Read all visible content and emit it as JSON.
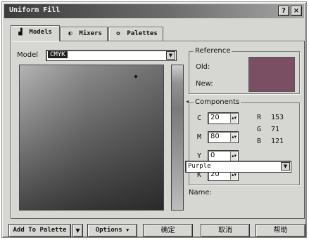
{
  "window": {
    "title": "Uniform Fill"
  },
  "title_buttons": {
    "help": "?",
    "close": "×"
  },
  "tabs": [
    {
      "label": "Models",
      "icon": "models-icon"
    },
    {
      "label": "Mixers",
      "icon": "mixers-icon"
    },
    {
      "label": "Palettes",
      "icon": "palettes-icon"
    }
  ],
  "model": {
    "label": "Model",
    "value": "CMYK"
  },
  "reference": {
    "legend": "Reference",
    "old_label": "Old:",
    "new_label": "New:",
    "old_color": "#7a4f63",
    "new_color": "#7a4f63"
  },
  "components": {
    "legend": "Components",
    "cmyk": [
      {
        "label": "C",
        "value": "20"
      },
      {
        "label": "M",
        "value": "80"
      },
      {
        "label": "Y",
        "value": "0"
      },
      {
        "label": "K",
        "value": "20"
      }
    ],
    "rgb": [
      {
        "label": "R",
        "value": "153"
      },
      {
        "label": "G",
        "value": "71"
      },
      {
        "label": "B",
        "value": "121"
      }
    ]
  },
  "name": {
    "label": "Name:",
    "value": "Purple"
  },
  "buttons": {
    "add_to_palette": "Add To Palette",
    "options": "Options",
    "ok": "确定",
    "cancel": "取消",
    "help": "帮助"
  },
  "colors": {
    "dialog_bg": "#d6d6d2",
    "title_bar": "#3c3c3c",
    "purple_swatch": "#7a4f63"
  }
}
